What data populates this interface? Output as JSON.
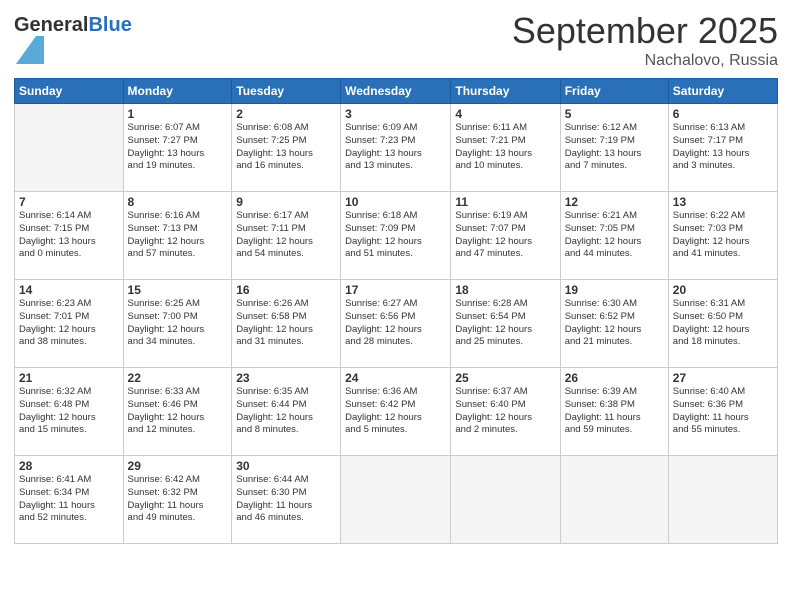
{
  "logo": {
    "general": "General",
    "blue": "Blue"
  },
  "title": {
    "month": "September 2025",
    "location": "Nachalovo, Russia"
  },
  "days_of_week": [
    "Sunday",
    "Monday",
    "Tuesday",
    "Wednesday",
    "Thursday",
    "Friday",
    "Saturday"
  ],
  "weeks": [
    [
      {
        "day": "",
        "info": ""
      },
      {
        "day": "1",
        "info": "Sunrise: 6:07 AM\nSunset: 7:27 PM\nDaylight: 13 hours\nand 19 minutes."
      },
      {
        "day": "2",
        "info": "Sunrise: 6:08 AM\nSunset: 7:25 PM\nDaylight: 13 hours\nand 16 minutes."
      },
      {
        "day": "3",
        "info": "Sunrise: 6:09 AM\nSunset: 7:23 PM\nDaylight: 13 hours\nand 13 minutes."
      },
      {
        "day": "4",
        "info": "Sunrise: 6:11 AM\nSunset: 7:21 PM\nDaylight: 13 hours\nand 10 minutes."
      },
      {
        "day": "5",
        "info": "Sunrise: 6:12 AM\nSunset: 7:19 PM\nDaylight: 13 hours\nand 7 minutes."
      },
      {
        "day": "6",
        "info": "Sunrise: 6:13 AM\nSunset: 7:17 PM\nDaylight: 13 hours\nand 3 minutes."
      }
    ],
    [
      {
        "day": "7",
        "info": "Sunrise: 6:14 AM\nSunset: 7:15 PM\nDaylight: 13 hours\nand 0 minutes."
      },
      {
        "day": "8",
        "info": "Sunrise: 6:16 AM\nSunset: 7:13 PM\nDaylight: 12 hours\nand 57 minutes."
      },
      {
        "day": "9",
        "info": "Sunrise: 6:17 AM\nSunset: 7:11 PM\nDaylight: 12 hours\nand 54 minutes."
      },
      {
        "day": "10",
        "info": "Sunrise: 6:18 AM\nSunset: 7:09 PM\nDaylight: 12 hours\nand 51 minutes."
      },
      {
        "day": "11",
        "info": "Sunrise: 6:19 AM\nSunset: 7:07 PM\nDaylight: 12 hours\nand 47 minutes."
      },
      {
        "day": "12",
        "info": "Sunrise: 6:21 AM\nSunset: 7:05 PM\nDaylight: 12 hours\nand 44 minutes."
      },
      {
        "day": "13",
        "info": "Sunrise: 6:22 AM\nSunset: 7:03 PM\nDaylight: 12 hours\nand 41 minutes."
      }
    ],
    [
      {
        "day": "14",
        "info": "Sunrise: 6:23 AM\nSunset: 7:01 PM\nDaylight: 12 hours\nand 38 minutes."
      },
      {
        "day": "15",
        "info": "Sunrise: 6:25 AM\nSunset: 7:00 PM\nDaylight: 12 hours\nand 34 minutes."
      },
      {
        "day": "16",
        "info": "Sunrise: 6:26 AM\nSunset: 6:58 PM\nDaylight: 12 hours\nand 31 minutes."
      },
      {
        "day": "17",
        "info": "Sunrise: 6:27 AM\nSunset: 6:56 PM\nDaylight: 12 hours\nand 28 minutes."
      },
      {
        "day": "18",
        "info": "Sunrise: 6:28 AM\nSunset: 6:54 PM\nDaylight: 12 hours\nand 25 minutes."
      },
      {
        "day": "19",
        "info": "Sunrise: 6:30 AM\nSunset: 6:52 PM\nDaylight: 12 hours\nand 21 minutes."
      },
      {
        "day": "20",
        "info": "Sunrise: 6:31 AM\nSunset: 6:50 PM\nDaylight: 12 hours\nand 18 minutes."
      }
    ],
    [
      {
        "day": "21",
        "info": "Sunrise: 6:32 AM\nSunset: 6:48 PM\nDaylight: 12 hours\nand 15 minutes."
      },
      {
        "day": "22",
        "info": "Sunrise: 6:33 AM\nSunset: 6:46 PM\nDaylight: 12 hours\nand 12 minutes."
      },
      {
        "day": "23",
        "info": "Sunrise: 6:35 AM\nSunset: 6:44 PM\nDaylight: 12 hours\nand 8 minutes."
      },
      {
        "day": "24",
        "info": "Sunrise: 6:36 AM\nSunset: 6:42 PM\nDaylight: 12 hours\nand 5 minutes."
      },
      {
        "day": "25",
        "info": "Sunrise: 6:37 AM\nSunset: 6:40 PM\nDaylight: 12 hours\nand 2 minutes."
      },
      {
        "day": "26",
        "info": "Sunrise: 6:39 AM\nSunset: 6:38 PM\nDaylight: 11 hours\nand 59 minutes."
      },
      {
        "day": "27",
        "info": "Sunrise: 6:40 AM\nSunset: 6:36 PM\nDaylight: 11 hours\nand 55 minutes."
      }
    ],
    [
      {
        "day": "28",
        "info": "Sunrise: 6:41 AM\nSunset: 6:34 PM\nDaylight: 11 hours\nand 52 minutes."
      },
      {
        "day": "29",
        "info": "Sunrise: 6:42 AM\nSunset: 6:32 PM\nDaylight: 11 hours\nand 49 minutes."
      },
      {
        "day": "30",
        "info": "Sunrise: 6:44 AM\nSunset: 6:30 PM\nDaylight: 11 hours\nand 46 minutes."
      },
      {
        "day": "",
        "info": ""
      },
      {
        "day": "",
        "info": ""
      },
      {
        "day": "",
        "info": ""
      },
      {
        "day": "",
        "info": ""
      }
    ]
  ]
}
